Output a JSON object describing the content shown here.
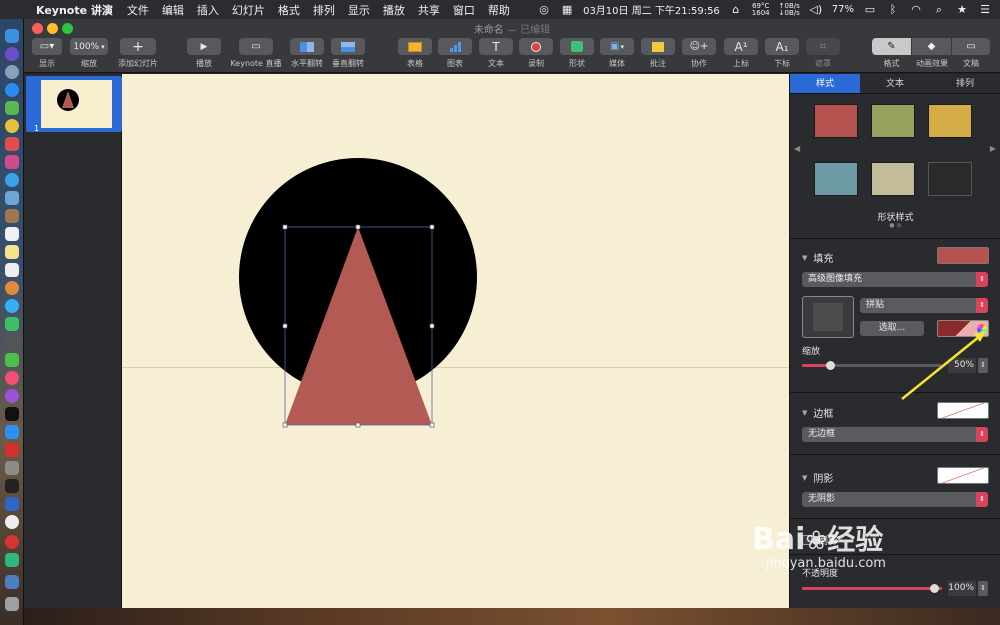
{
  "menubar": {
    "app_name": "Keynote 讲演",
    "items": [
      "文件",
      "编辑",
      "插入",
      "幻灯片",
      "格式",
      "排列",
      "显示",
      "播放",
      "共享",
      "窗口",
      "帮助"
    ],
    "temp": "69°C",
    "rpm": "1604",
    "net_up": "↑0B/s",
    "net_down": "↓0B/s",
    "clock": "03月10日 周二 下午21:59:56",
    "battery": "77%"
  },
  "window": {
    "title": "未命名",
    "title_suffix": "— 已编辑"
  },
  "toolbar": {
    "display_label": "显示",
    "zoom_value": "100%",
    "zoom_label": "缩放",
    "add_slide_label": "添加幻灯片",
    "play_label": "播放",
    "keynote_live_label": "Keynote 直播",
    "flip_h_label": "水平翻转",
    "flip_v_label": "垂直翻转",
    "table_label": "表格",
    "chart_label": "图表",
    "text_label": "文本",
    "record_label": "录制",
    "shape_label": "形状",
    "media_label": "媒体",
    "comment_label": "批注",
    "collaborate_label": "协作",
    "superscript_label": "上标",
    "subscript_label": "下标",
    "mask_label": "遮罩",
    "format_label": "格式",
    "animate_label": "动画效果",
    "document_label": "文稿"
  },
  "navigator": {
    "slide_number": "1"
  },
  "inspector": {
    "tabs": [
      "样式",
      "文本",
      "排列"
    ],
    "shape_styles_label": "形状样式",
    "swatch_colors": [
      "#b4534f",
      "#94a25e",
      "#d4ac45",
      "#6c9aa5",
      "#c3bc9b",
      "#2a2a2a"
    ],
    "fill": {
      "label": "填充",
      "type": "高级图像填充",
      "scale_mode": "拼贴",
      "choose_button": "选取...",
      "scale_label": "缩放",
      "scale_value": "50%",
      "color": "#b4534f"
    },
    "border": {
      "label": "边框",
      "value": "无边框"
    },
    "shadow": {
      "label": "阴影",
      "value": "无阴影"
    },
    "reflection": {
      "label": "倒影"
    },
    "opacity": {
      "label": "不透明度",
      "value": "100%"
    }
  },
  "watermark": {
    "brand": "Bai",
    "brand2": "经验",
    "url": "jingyan.baidu.com"
  }
}
